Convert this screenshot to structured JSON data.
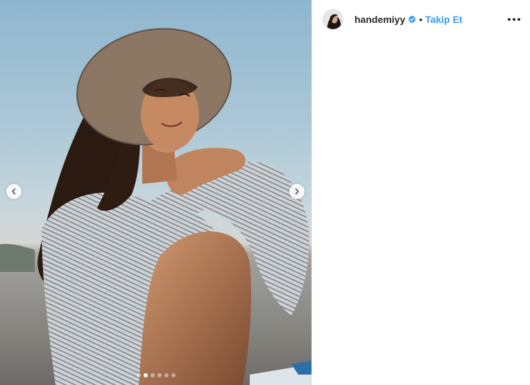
{
  "post": {
    "username": "handemiyy",
    "separator": "•",
    "follow_label": "Takip Et",
    "verified": true,
    "more_icon": "more-options-icon"
  },
  "carousel": {
    "slide_count": 6,
    "active_index": 1,
    "prev_icon": "chevron-left-icon",
    "next_icon": "chevron-right-icon"
  },
  "colors": {
    "link_blue": "#3897f0",
    "verified_blue": "#3897f0",
    "text_dark": "#262626"
  }
}
